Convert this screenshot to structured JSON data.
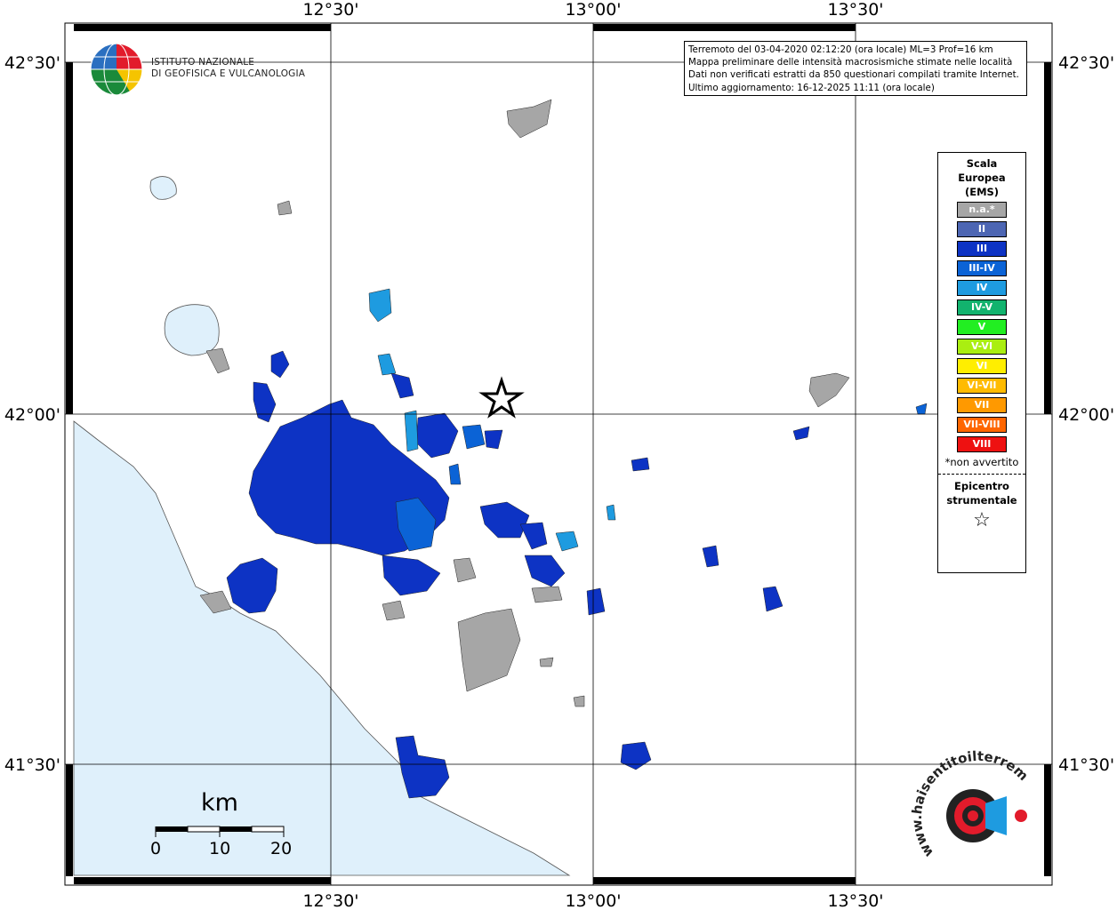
{
  "map": {
    "lon_labels": [
      "12°30'",
      "13°00'",
      "13°30'"
    ],
    "lat_labels": [
      "42°30'",
      "42°00'",
      "41°30'"
    ],
    "colors": {
      "sea": "#dff0fb",
      "land": "#ffffff",
      "grid": "#000000"
    }
  },
  "info": {
    "line1": "Terremoto del 03-04-2020 02:12:20 (ora locale) ML=3 Prof=16 km",
    "line2": "Mappa preliminare delle intensità macrosismiche stimate nelle località",
    "line3": "Dati non verificati estratti da 850 questionari compilati tramite Internet.",
    "line4": "Ultimo aggiornamento: 16-12-2025 11:11 (ora locale)"
  },
  "logo": {
    "line1": "ISTITUTO NAZIONALE",
    "line2": "DI GEOFISICA E VULCANOLOGIA"
  },
  "legend": {
    "title1": "Scala",
    "title2": "Europea",
    "title3": "(EMS)",
    "items": [
      {
        "label": "n.a.*",
        "color": "#a6a6a6"
      },
      {
        "label": "II",
        "color": "#4d66b3"
      },
      {
        "label": "III",
        "color": "#0d33c4"
      },
      {
        "label": "III-IV",
        "color": "#0b63d6"
      },
      {
        "label": "IV",
        "color": "#1e9be0"
      },
      {
        "label": "IV-V",
        "color": "#12b36e"
      },
      {
        "label": "V",
        "color": "#22ee22"
      },
      {
        "label": "V-VI",
        "color": "#aaee11"
      },
      {
        "label": "VI",
        "color": "#ffee00"
      },
      {
        "label": "VI-VII",
        "color": "#ffbb00"
      },
      {
        "label": "VII",
        "color": "#ff9900"
      },
      {
        "label": "VII-VIII",
        "color": "#ff6600"
      },
      {
        "label": "VIII",
        "color": "#ee1111"
      }
    ],
    "note": "*non avvertito",
    "epicenter1": "Epicentro",
    "epicenter2": "strumentale"
  },
  "scale": {
    "title": "km",
    "labels": [
      "0",
      "10",
      "20"
    ]
  },
  "watermark": {
    "text": "www.haisentitoilterremoto.it"
  }
}
